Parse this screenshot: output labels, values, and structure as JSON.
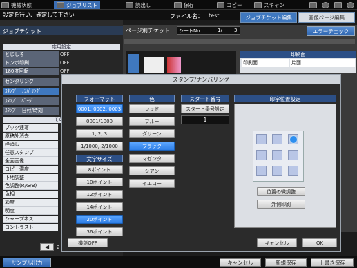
{
  "topbar": {
    "items": [
      {
        "label": "機械状態",
        "icon": "machine-status-icon"
      },
      {
        "label": "ジョブリスト",
        "icon": "job-list-icon"
      },
      {
        "label": "読出し",
        "icon": "recall-icon"
      },
      {
        "label": "保存",
        "icon": "save-icon"
      },
      {
        "label": "コピー",
        "icon": "copy-icon"
      },
      {
        "label": "スキャン",
        "icon": "scan-icon"
      }
    ]
  },
  "message": "設定を行い、確定して下さい",
  "filename_label": "ファイル名：",
  "filename": "test",
  "tabs": {
    "job_ticket_edit": "ジョブチケット編集",
    "image_page_edit": "画像ページ編集"
  },
  "error_check": "エラーチェック",
  "job_ticket": {
    "title": "ジョブチケット",
    "section_applied": "応用設定",
    "rows": [
      {
        "label": "とじしろ",
        "value": "OFF"
      },
      {
        "label": "トンボ印刷",
        "value": "OFF"
      },
      {
        "label": "180度回転",
        "value": "OFF"
      },
      {
        "label": "センタリング",
        "value": ""
      },
      {
        "label": "ｽﾀﾝﾌﾟ　ﾅﾝﾊﾞﾘﾝｸﾞ",
        "value": ""
      },
      {
        "label": "ｽﾀﾝﾌﾟ　ﾍﾟｰｼﾞ",
        "value": ""
      },
      {
        "label": "ｽﾀﾝﾌﾟ　日付/時刻",
        "value": ""
      }
    ],
    "section_other": "その他",
    "list": [
      "ブック連写",
      "原稿外消去",
      "枠消し",
      "任意スタンプ",
      "全面画像",
      "コピー濃度",
      "下地調整",
      "色調整(R/G/B)",
      "色相",
      "彩度",
      "明度",
      "シャープネス",
      "コントラスト"
    ],
    "page_counter": "2"
  },
  "page_ticket": {
    "title": "ページ別チケット",
    "sheet_label": "シートNo.",
    "sheet_current": "1/",
    "sheet_total": "3",
    "print_side_head": "印刷面",
    "print_side_label": "印刷面",
    "print_side_value": "片面"
  },
  "dialog": {
    "title": "スタンプ/ナンバリング",
    "format_head": "フォーマット",
    "formats": [
      "0001, 0002, 0003",
      "0001/1000",
      "1, 2, 3",
      "1/1000, 2/1000"
    ],
    "format_selected": 0,
    "size_head": "文字サイズ",
    "sizes": [
      "8ポイント",
      "10ポイント",
      "12ポイント",
      "14ポイント",
      "20ポイント",
      "36ポイント"
    ],
    "size_selected": 4,
    "color_head": "色",
    "colors": [
      "レッド",
      "ブルー",
      "グリーン",
      "ブラック",
      "マゼンタ",
      "シアン",
      "イエロー"
    ],
    "color_selected": 3,
    "start_head": "スタート番号",
    "start_button": "スタート番号設定",
    "start_value": "1",
    "position_head": "印字位置設定",
    "fine_adjust": "位置の微調整",
    "outside_print": "外側印刷",
    "func_off": "機能OFF",
    "cancel": "キャンセル",
    "ok": "OK"
  },
  "bottombar": {
    "sample_output": "サンプル出力",
    "cancel": "キャンセル",
    "new_save": "新規保存",
    "overwrite_save": "上書き保存"
  }
}
